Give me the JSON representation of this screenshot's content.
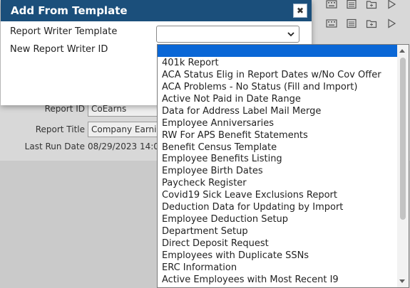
{
  "dialog": {
    "title": "Add From Template",
    "close_icon": "close-icon",
    "template_label": "Report Writer Template",
    "new_id_label": "New Report Writer ID",
    "template_value": ""
  },
  "background_form": {
    "report_id_label": "Report ID",
    "report_id_value": "CoEarns",
    "report_title_label": "Report Title",
    "report_title_value": "Company Earni",
    "last_run_label": "Last Run Date",
    "last_run_value": "08/29/2023 14:0"
  },
  "toolbar_icons": [
    "keyboard-icon",
    "list-icon",
    "folder-add-icon",
    "play-icon"
  ],
  "dropdown": {
    "selected_index": 0,
    "options": [
      "",
      "401k Report",
      "ACA Status Elig in Report Dates w/No Cov Offer",
      "ACA Problems - No Status (Fill and Import)",
      "Active Not Paid in Date Range",
      "Data for Address Label Mail Merge",
      "Employee Anniversaries",
      "RW For APS Benefit Statements",
      "Benefit Census Template",
      "Employee Benefits Listing",
      "Employee Birth Dates",
      "Paycheck Register",
      "Covid19 Sick Leave Exclusions Report",
      "Deduction Data for Updating by Import",
      "Employee Deduction Setup",
      "Department Setup",
      "Direct Deposit Request",
      "Employees with Duplicate SSNs",
      "ERC Information",
      "Active Employees with Most Recent I9"
    ]
  },
  "colors": {
    "header_bg": "#1b4f7b",
    "selected_option": "#0a67d6"
  }
}
